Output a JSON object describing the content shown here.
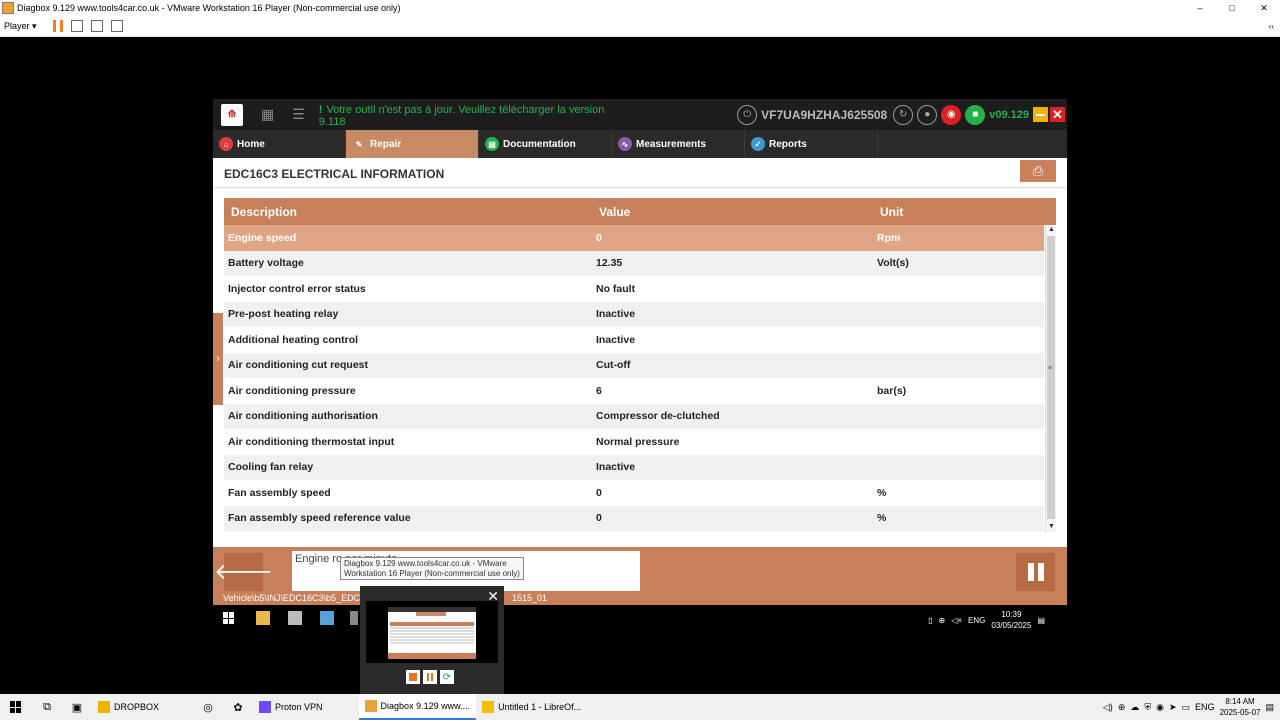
{
  "host_window": {
    "title": "Diagbox 9.129 www.tools4car.co.uk - VMware Workstation 16 Player (Non-commercial use only)",
    "minimize": "–",
    "maximize": "□",
    "close": "✕"
  },
  "vm_toolbar": {
    "player_label": "Player ▾",
    "right_label": "‹‹"
  },
  "app": {
    "update_warning_mark": "!",
    "update_warning": "Votre outil n'est pas à jour. Veuillez télécharger la version 9.118",
    "vin": "VF7UA9HZHAJ625508",
    "version": "v09.129",
    "nav_tabs": [
      {
        "label": "Home",
        "color": "#e03a3a",
        "icon": "home-icon",
        "glyph": "⌂"
      },
      {
        "label": "Repair",
        "color": "#c98a66",
        "icon": "repair-icon",
        "glyph": "✎"
      },
      {
        "label": "Documentation",
        "color": "#25b14a",
        "icon": "documentation-icon",
        "glyph": "▤"
      },
      {
        "label": "Measurements",
        "color": "#8a5aa8",
        "icon": "measurements-icon",
        "glyph": "∿"
      },
      {
        "label": "Reports",
        "color": "#3a9ad5",
        "icon": "reports-icon",
        "glyph": "✓"
      }
    ],
    "page_title": "EDC16C3 ELECTRICAL INFORMATION",
    "table": {
      "headers": {
        "description": "Description",
        "value": "Value",
        "unit": "Unit"
      },
      "rows": [
        {
          "description": "Engine speed",
          "value": "0",
          "unit": "Rpm"
        },
        {
          "description": "Battery voltage",
          "value": "12.35",
          "unit": "Volt(s)"
        },
        {
          "description": "Injector control error status",
          "value": "No fault",
          "unit": ""
        },
        {
          "description": "Pre-post heating relay",
          "value": "Inactive",
          "unit": ""
        },
        {
          "description": "Additional heating control",
          "value": "Inactive",
          "unit": ""
        },
        {
          "description": "Air conditioning cut request",
          "value": "Cut-off",
          "unit": ""
        },
        {
          "description": "Air conditioning pressure",
          "value": "6",
          "unit": "bar(s)"
        },
        {
          "description": "Air conditioning authorisation",
          "value": "Compressor de-clutched",
          "unit": ""
        },
        {
          "description": "Air conditioning thermostat input",
          "value": "Normal pressure",
          "unit": ""
        },
        {
          "description": "Cooling fan relay",
          "value": "Inactive",
          "unit": ""
        },
        {
          "description": "Fan assembly speed",
          "value": "0",
          "unit": "%"
        },
        {
          "description": "Fan assembly speed reference value",
          "value": "0",
          "unit": "%"
        }
      ]
    },
    "message_box": "Engine ro                                                          per minute",
    "path": "Vehicle\\b5\\INJ\\EDC16C3\\b5_EDC1",
    "path_suffix": "1515_01"
  },
  "guest_taskbar": {
    "lang": "ENG",
    "time": "10:39",
    "date": "03/05/2025"
  },
  "tooltip": {
    "text": "Diagbox 9.129 www.tools4car.co.uk - VMware Workstation 16 Player (Non-commercial use only)"
  },
  "host_taskbar": {
    "apps": [
      {
        "label": "DROPBOX",
        "color": "#f0b400",
        "active": false
      },
      {
        "label": "Proton VPN",
        "color": "#6d4aff",
        "active": false
      },
      {
        "label": "Diagbox 9.129 www....",
        "color": "#e8a33a",
        "active": true
      },
      {
        "label": "Untitled 1 - LibreOf...",
        "color": "#f0c000",
        "active": false
      }
    ],
    "lang": "ENG",
    "time": "8:14 AM",
    "date": "2025-05-07"
  },
  "colors": {
    "accent": "#c8805a",
    "selected_row": "#e0a584",
    "ok_green": "#25b14a",
    "alert_red": "#e02020"
  }
}
